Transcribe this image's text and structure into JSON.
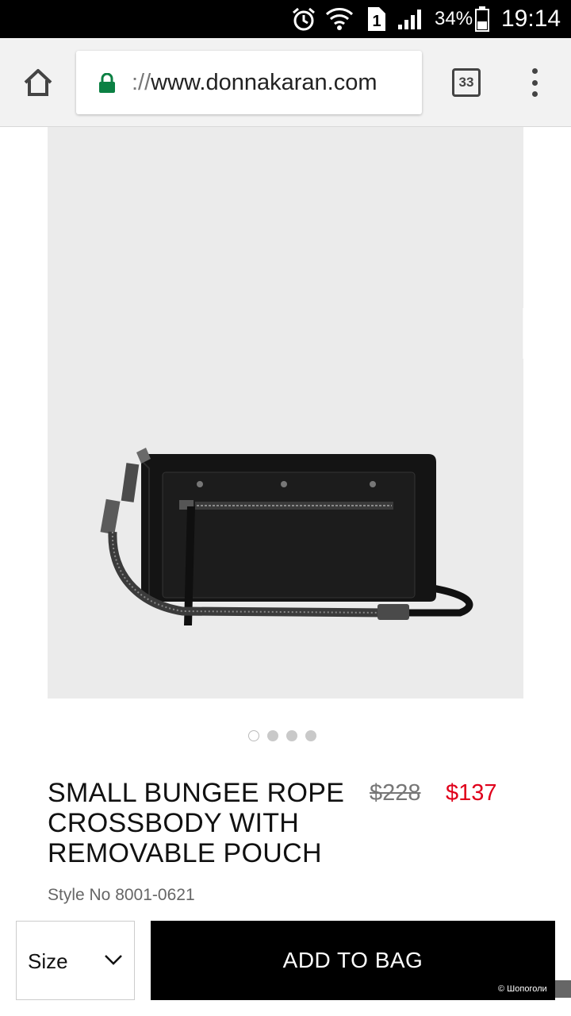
{
  "status_bar": {
    "sim_slot": "1",
    "battery_percent": "34%",
    "time": "19:14",
    "icons": [
      "alarm-icon",
      "wifi-icon",
      "sim-icon",
      "signal-icon",
      "battery-icon"
    ]
  },
  "browser": {
    "url_scheme": "://",
    "url_host": "www.donnakaran.com",
    "tab_count": "33",
    "icons": [
      "home-icon",
      "lock-icon",
      "more-vert-icon"
    ]
  },
  "gallery": {
    "image_description_icon": "crossbody-bag-image",
    "dots_total": 4,
    "active_index": 0
  },
  "product": {
    "title": "SMALL BUNGEE ROPE CROSSBODY WITH REMOVABLE POUCH",
    "price_original": "$228",
    "price_sale": "$137",
    "style_no": "Style No 8001-0621"
  },
  "actions": {
    "size_label": "Size",
    "add_to_bag_label": "ADD TO BAG"
  },
  "watermark": "© Шопоголи",
  "colors": {
    "sale_price": "#e0001b",
    "lock": "#0b8043",
    "button_bg": "#000000"
  }
}
